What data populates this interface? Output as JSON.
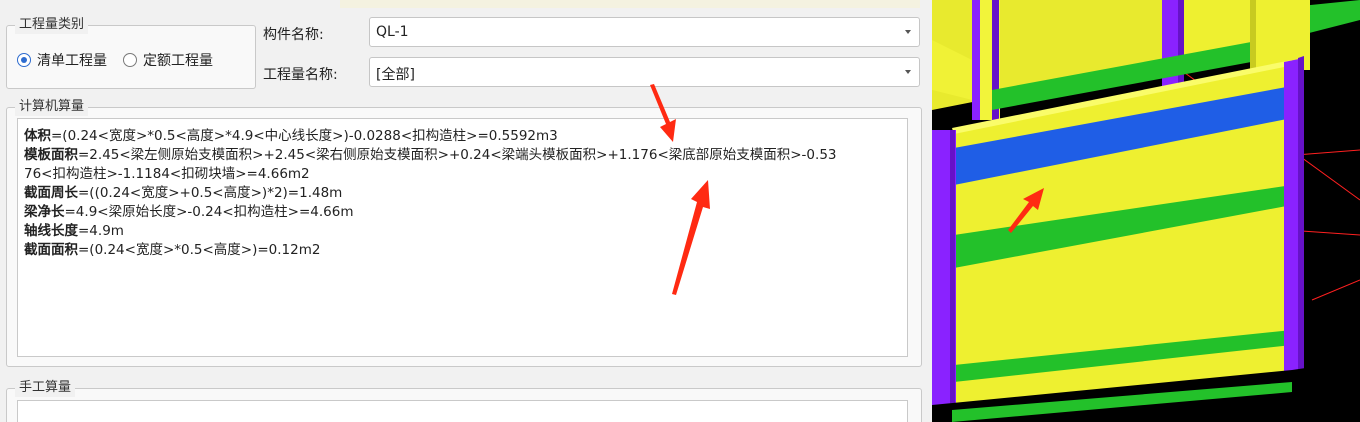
{
  "quantity_type": {
    "title": "工程量类别",
    "options": [
      {
        "label": "清单工程量",
        "checked": true
      },
      {
        "label": "定额工程量",
        "checked": false
      }
    ]
  },
  "component": {
    "name_label": "构件名称:",
    "name_value": "QL-1",
    "qty_label": "工程量名称:",
    "qty_value": "[全部]"
  },
  "computer_calc": {
    "title": "计算机算量",
    "lines": [
      {
        "key": "体积",
        "expr": "=(0.24<宽度>*0.5<高度>*4.9<中心线长度>)-0.0288<扣构造柱>=0.5592m3"
      },
      {
        "key": "模板面积",
        "expr": "=2.45<梁左侧原始支模面积>+2.45<梁右侧原始支模面积>+0.24<梁端头模板面积>+1.176<梁底部原始支模面积>-0.53"
      },
      {
        "key": "",
        "expr": "76<扣构造柱>-1.1184<扣砌块墙>=4.66m2"
      },
      {
        "key": "截面周长",
        "expr": "=((0.24<宽度>+0.5<高度>)*2)=1.48m"
      },
      {
        "key": "梁净长",
        "expr": "=4.9<梁原始长度>-0.24<扣构造柱>=4.66m"
      },
      {
        "key": "轴线长度",
        "expr": "=4.9m"
      },
      {
        "key": "截面面积",
        "expr": "=(0.24<宽度>*0.5<高度>)=0.12m2"
      }
    ]
  },
  "manual_calc": {
    "title": "手工算量"
  },
  "colors": {
    "wall_yellow": "#eef030",
    "beam_blue": "#1f5ee6",
    "band_green": "#23c12a",
    "column_purple": "#7a18e8",
    "annotation_red": "#ff2a12"
  }
}
